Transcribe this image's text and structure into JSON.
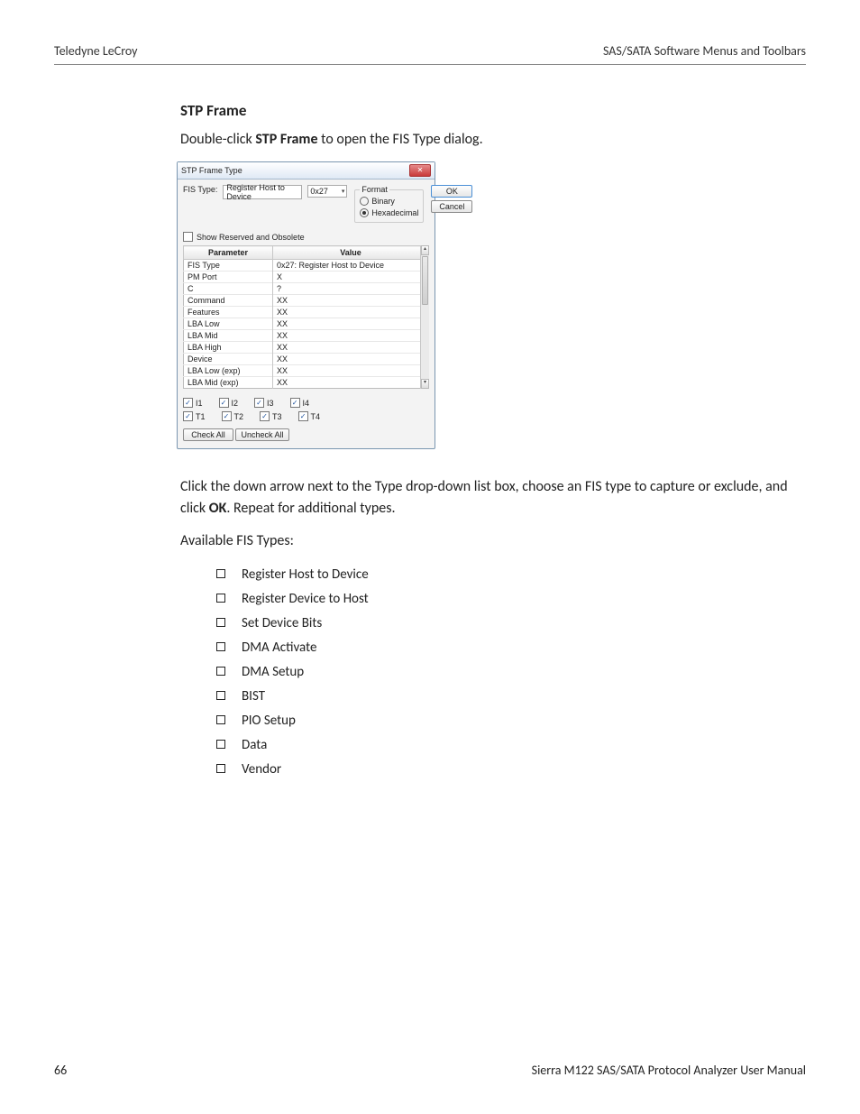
{
  "header": {
    "left": "Teledyne LeCroy",
    "right": "SAS/SATA Software Menus and Toolbars"
  },
  "section": {
    "title": "STP Frame",
    "intro_pre": "Double-click ",
    "intro_bold": "STP Frame",
    "intro_post": " to open the FIS Type dialog.",
    "after_dialog_1a": "Click the down arrow next to the Type drop-down list box, choose an FIS type to capture or exclude, and click ",
    "after_dialog_1b": "OK",
    "after_dialog_1c": ". Repeat for additional types.",
    "after_dialog_2": "Available FIS Types:",
    "fis_types": [
      "Register Host to Device",
      "Register Device to Host",
      "Set Device Bits",
      "DMA Activate",
      "DMA Setup",
      "BIST",
      "PIO Setup",
      "Data",
      "Vendor"
    ]
  },
  "dialog": {
    "title": "STP Frame Type",
    "fis_type_label": "FIS Type:",
    "fis_type_value": "Register Host to Device",
    "fis_type_code": "0x27",
    "format": {
      "legend": "Format",
      "binary": "Binary",
      "hex": "Hexadecimal",
      "selected": "hex"
    },
    "ok": "OK",
    "cancel": "Cancel",
    "show_reserved": "Show Reserved and Obsolete",
    "table_header": {
      "param": "Parameter",
      "value": "Value"
    },
    "rows": [
      {
        "p": "FIS Type",
        "v": "0x27: Register Host to Device"
      },
      {
        "p": "PM Port",
        "v": "X"
      },
      {
        "p": "C",
        "v": "?"
      },
      {
        "p": "Command",
        "v": "XX"
      },
      {
        "p": "Features",
        "v": "XX"
      },
      {
        "p": "LBA Low",
        "v": "XX"
      },
      {
        "p": "LBA Mid",
        "v": "XX"
      },
      {
        "p": "LBA High",
        "v": "XX"
      },
      {
        "p": "Device",
        "v": "XX"
      },
      {
        "p": "LBA Low (exp)",
        "v": "XX"
      },
      {
        "p": "LBA Mid (exp)",
        "v": "XX"
      }
    ],
    "checks_row1": [
      "I1",
      "I2",
      "I3",
      "I4"
    ],
    "checks_row2": [
      "T1",
      "T2",
      "T3",
      "T4"
    ],
    "check_all": "Check All",
    "uncheck_all": "Uncheck All"
  },
  "footer": {
    "page": "66",
    "book": "Sierra M122 SAS/SATA Protocol Analyzer User Manual"
  }
}
